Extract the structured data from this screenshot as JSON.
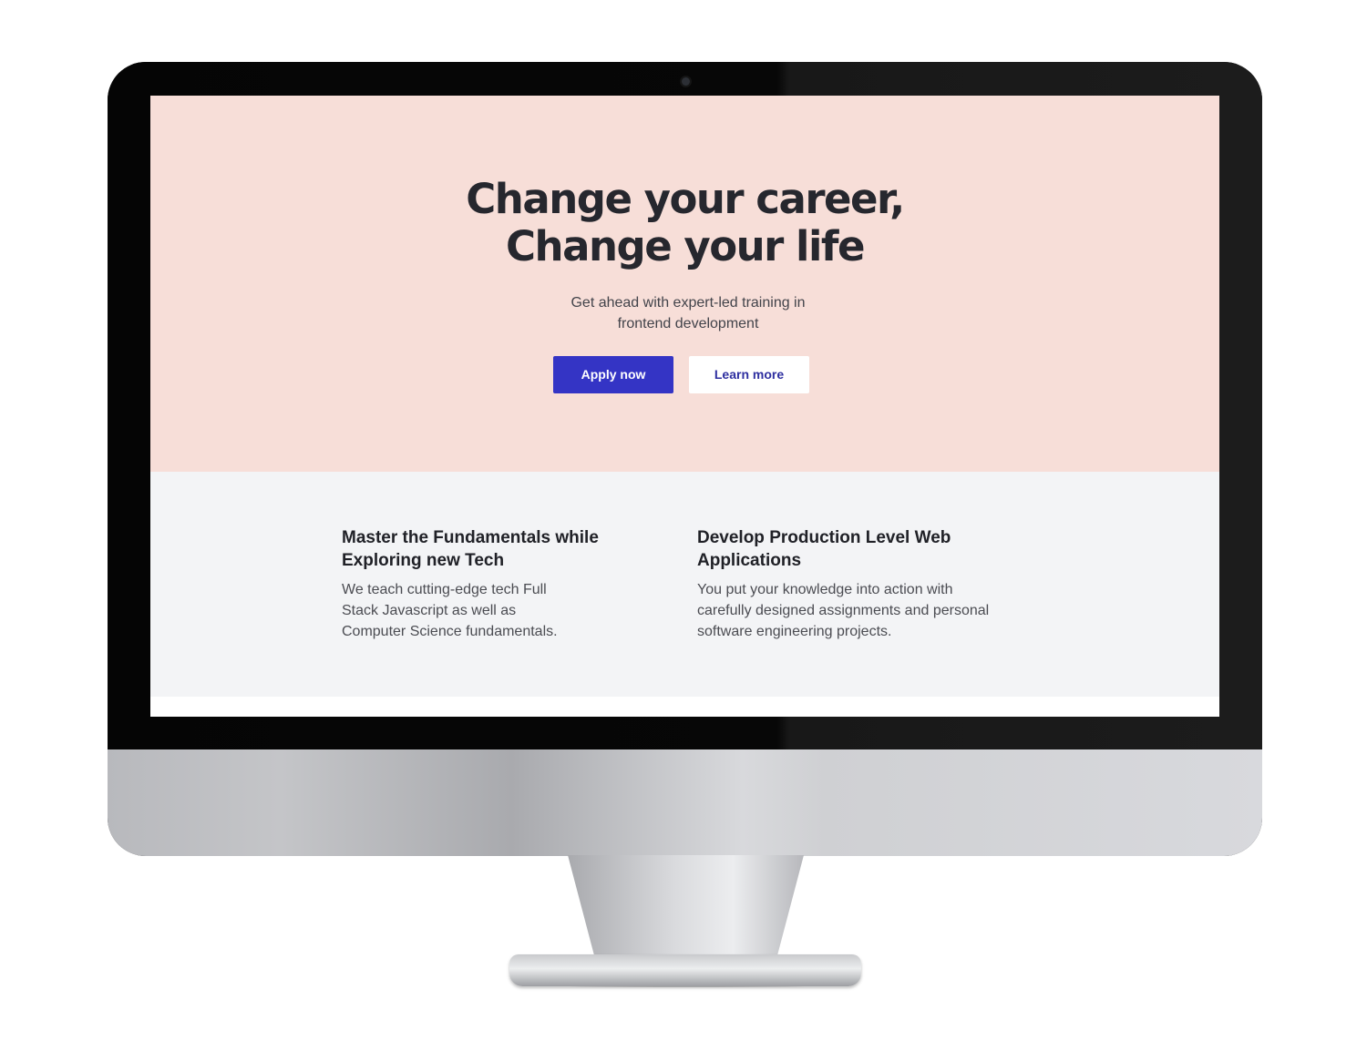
{
  "hero": {
    "title_line_1": "Change your career,",
    "title_line_2": "Change your life",
    "subtitle_line_1": "Get ahead with expert-led training in",
    "subtitle_line_2": "frontend development",
    "primary_button": "Apply now",
    "secondary_button": "Learn more",
    "background": "#f7ded8",
    "accent": "#3434c5"
  },
  "features": [
    {
      "title_line_1": "Master the Fundamentals while",
      "title_line_2": "Exploring new Tech",
      "text_line_1": "We teach cutting-edge tech Full",
      "text_line_2": "Stack Javascript as well as",
      "text_line_3": "Computer Science fundamentals."
    },
    {
      "title_line_1": "Develop Production Level Web",
      "title_line_2": "Applications",
      "text_line_1": "You put your knowledge into action with",
      "text_line_2": "carefully designed assignments and personal",
      "text_line_3": "software engineering projects."
    }
  ],
  "icons": {
    "camera": "camera-icon"
  }
}
